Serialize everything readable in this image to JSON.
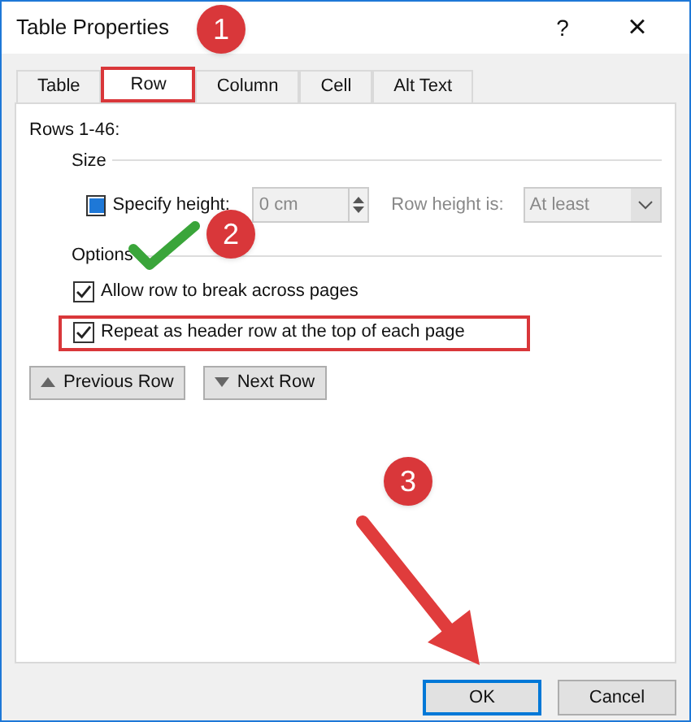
{
  "window": {
    "title": "Table Properties",
    "help": "?",
    "close": "×"
  },
  "tabs": [
    {
      "label": "Table",
      "selected": false
    },
    {
      "label": "Row",
      "selected": true
    },
    {
      "label": "Column",
      "selected": false
    },
    {
      "label": "Cell",
      "selected": false
    },
    {
      "label": "Alt Text",
      "selected": false
    }
  ],
  "rows_label": "Rows 1-46:",
  "size": {
    "heading": "Size",
    "specify": {
      "label": "Specify height:",
      "kind": "mixed"
    },
    "height": {
      "value": "0 cm",
      "disabled": true
    },
    "height_is": {
      "label": "Row height is:",
      "value": "At least",
      "disabled": true
    }
  },
  "options": {
    "heading": "Options",
    "items": [
      {
        "label": "Allow row to break across pages",
        "checked": true,
        "highlighted": false
      },
      {
        "label": "Repeat as header row at the top of each page",
        "checked": true,
        "highlighted": true
      }
    ]
  },
  "nav_buttons": [
    {
      "label": "Previous Row",
      "kind": "previous"
    },
    {
      "label": "Next Row",
      "kind": "next"
    }
  ],
  "footer_buttons": [
    {
      "label": "OK",
      "default": true
    },
    {
      "label": "Cancel",
      "default": false
    }
  ],
  "annotations": [
    {
      "kind": "badge",
      "label": "1"
    },
    {
      "kind": "badge",
      "label": "2"
    },
    {
      "kind": "badge",
      "label": "3"
    },
    {
      "kind": "tick"
    },
    {
      "kind": "arrow"
    }
  ]
}
